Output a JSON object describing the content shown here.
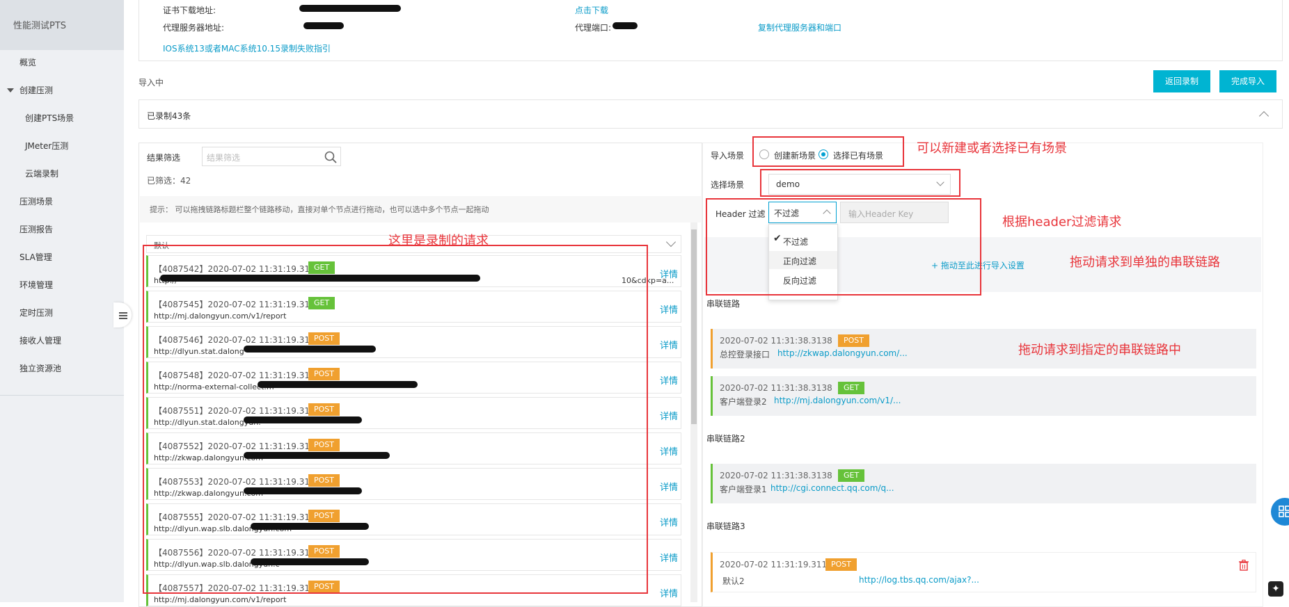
{
  "sidebar": {
    "brand": "性能测试PTS",
    "items": [
      {
        "label": "概览"
      },
      {
        "label": "创建压测"
      },
      {
        "label": "创建PTS场景"
      },
      {
        "label": "JMeter压测"
      },
      {
        "label": "云端录制"
      },
      {
        "label": "压测场景"
      },
      {
        "label": "压测报告"
      },
      {
        "label": "SLA管理"
      },
      {
        "label": "环境管理"
      },
      {
        "label": "定时压测"
      },
      {
        "label": "接收人管理"
      },
      {
        "label": "独立资源池"
      }
    ]
  },
  "info": {
    "cert_label": "证书下载地址:",
    "cert_link": "点击下载",
    "proxy_label": "代理服务器地址:",
    "port_label": "代理端口:",
    "copy_link": "复制代理服务器和端口",
    "ios_link": "IOS系统13或者MAC系统10.15录制失败指引"
  },
  "status": "导入中",
  "buttons": {
    "back": "返回录制",
    "finish": "完成导入"
  },
  "recorded_count": "已录制43条",
  "filter": {
    "label": "结果筛选",
    "placeholder": "结果筛选",
    "count": "已筛选：42"
  },
  "tip": "提示：  可以拖拽链路标题栏整个链路移动，直接对单个节点进行拖动，也可以选中多个节点一起拖动",
  "default_group": "默认",
  "detail_label": "详情",
  "requests": [
    {
      "id": "【4087542】2020-07-02 11:31:19.3119",
      "method": "GET",
      "url": "http://",
      "url_tail": "10&cdkp=a..."
    },
    {
      "id": "【4087545】2020-07-02 11:31:19.3119",
      "method": "GET",
      "url": "http://mj.dalongyun.com/v1/report"
    },
    {
      "id": "【4087546】2020-07-02 11:31:19.3119",
      "method": "POST",
      "url": "http://dlyun.stat.dalong"
    },
    {
      "id": "【4087548】2020-07-02 11:31:19.3119",
      "method": "POST",
      "url": "http://norma-external-collect.m"
    },
    {
      "id": "【4087551】2020-07-02 11:31:19.3119",
      "method": "POST",
      "url": "http://dlyun.stat.dalongyun."
    },
    {
      "id": "【4087552】2020-07-02 11:31:19.3119",
      "method": "POST",
      "url": "http://zkwap.dalongyun.com"
    },
    {
      "id": "【4087553】2020-07-02 11:31:19.3119",
      "method": "POST",
      "url": "http://zkwap.dalongyun.com"
    },
    {
      "id": "【4087555】2020-07-02 11:31:19.3119",
      "method": "POST",
      "url": "http://dlyun.wap.slb.dalongyun.com"
    },
    {
      "id": "【4087556】2020-07-02 11:31:19.3119",
      "method": "POST",
      "url": "http://dlyun.wap.slb.dalongyun.c"
    },
    {
      "id": "【4087557】2020-07-02 11:31:19.3119",
      "method": "POST",
      "url": "http://mj.dalongyun.com/v1/report"
    }
  ],
  "import": {
    "scene_label": "导入场景",
    "option_new": "创建新场景",
    "option_existing": "选择已有场景",
    "select_label": "选择场景",
    "selected_scene": "demo",
    "header_label": "Header 过滤",
    "header_value": "不过滤",
    "header_key_placeholder": "输入Header Key",
    "dropdown_options": [
      "不过滤",
      "正向过滤",
      "反向过滤"
    ],
    "drop_hint": "+ 拖动至此进行导入设置"
  },
  "chains": [
    {
      "title": "串联链路",
      "items": [
        {
          "time": "2020-07-02 11:31:38.3138",
          "method": "POST",
          "name": "总控登录接口",
          "url": "http://zkwap.dalongyun.com/..."
        },
        {
          "time": "2020-07-02 11:31:38.3138",
          "method": "GET",
          "name": "客户端登录2",
          "url": "http://mj.dalongyun.com/v1/..."
        }
      ]
    },
    {
      "title": "串联链路2",
      "items": [
        {
          "time": "2020-07-02 11:31:38.3138",
          "method": "GET",
          "name": "客户端登录1",
          "url": "http://cgi.connect.qq.com/q..."
        }
      ]
    },
    {
      "title": "串联链路3",
      "items": [
        {
          "time": "2020-07-02 11:31:19.3119",
          "method": "POST",
          "name": "默认2",
          "url": "http://log.tbs.qq.com/ajax?..."
        }
      ]
    }
  ],
  "annotations": {
    "scene": "可以新建或者选择已有场景",
    "recorded": "这里是录制的请求",
    "header": "根据header过滤请求",
    "drag_single": "拖动请求到单独的串联链路",
    "drag_chain": "拖动请求到指定的串联链路中"
  },
  "colors": {
    "accent": "#00b4d2",
    "get": "#66c23a",
    "post": "#f0a02f",
    "annotation": "#e8343a",
    "link": "#0a9bc8"
  }
}
